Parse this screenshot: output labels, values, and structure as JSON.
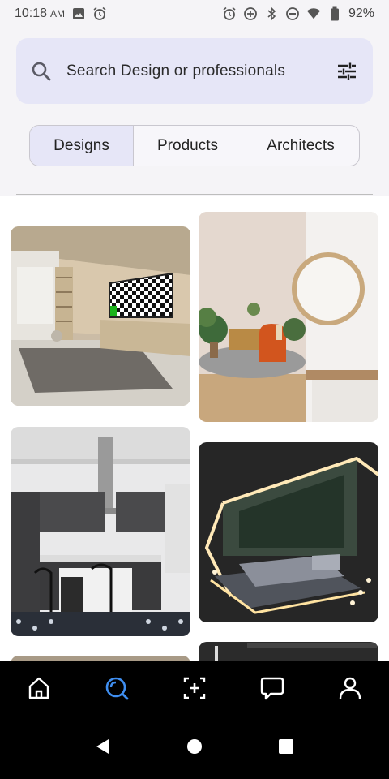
{
  "status_bar": {
    "time": "10:18",
    "ampm": "AM",
    "battery": "92%",
    "icons": [
      "gallery-icon",
      "alarm-icon",
      "alarm-icon",
      "data-saver-icon",
      "bluetooth-icon",
      "dnd-icon",
      "wifi-icon",
      "battery-icon"
    ]
  },
  "search": {
    "placeholder": "Search Design or professionals",
    "icon": "search-icon",
    "filter_icon": "tune-icon"
  },
  "tabs": [
    {
      "label": "Designs",
      "active": true
    },
    {
      "label": "Products",
      "active": false
    },
    {
      "label": "Architects",
      "active": false
    }
  ],
  "grid": {
    "cards": [
      {
        "subject": "living room with TV and shelves"
      },
      {
        "subject": "lounge with orange armchair and round mirror"
      },
      {
        "subject": "modern kitchen with island and range hood"
      },
      {
        "subject": "bedroom with glass roof and lit frame"
      },
      {
        "subject": "partial tile"
      },
      {
        "subject": "partial tile"
      }
    ]
  },
  "bottom_nav": [
    {
      "icon": "home-icon",
      "active": false
    },
    {
      "icon": "search-icon",
      "active": true
    },
    {
      "icon": "add-box-icon",
      "active": false
    },
    {
      "icon": "chat-icon",
      "active": false
    },
    {
      "icon": "profile-icon",
      "active": false
    }
  ],
  "colors": {
    "accent": "#3f8ef0",
    "search_bg": "#e6e6f7",
    "nav_bg": "#000000"
  }
}
